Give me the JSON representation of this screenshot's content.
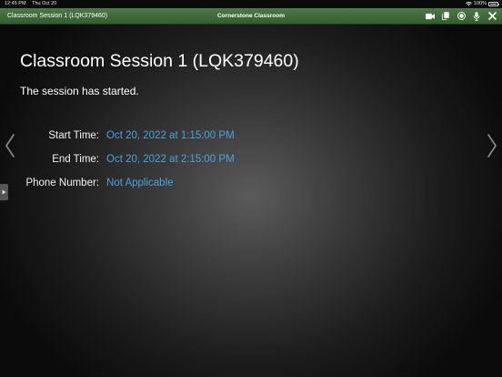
{
  "statusbar": {
    "time": "12:45 PM",
    "date": "Thu Oct 20",
    "battery": "100%"
  },
  "header": {
    "session_title": "Classroom Session 1 (LQK379460)",
    "app_title": "Cornerstone Classroom",
    "tools": [
      "video-camera-icon",
      "copy-icon",
      "record-icon",
      "microphone-icon",
      "close-icon"
    ]
  },
  "main": {
    "heading": "Classroom Session 1 (LQK379460)",
    "status": "The session has started.",
    "details": [
      {
        "label": "Start Time:",
        "value": "Oct 20, 2022 at 1:15:00 PM"
      },
      {
        "label": "End Time:",
        "value": "Oct 20, 2022 at 2:15:00 PM"
      },
      {
        "label": "Phone Number:",
        "value": "Not Applicable"
      }
    ]
  },
  "colors": {
    "header_green": "#3f6b3b",
    "value_blue": "#47a3dd",
    "background": "#2a2a2a"
  }
}
